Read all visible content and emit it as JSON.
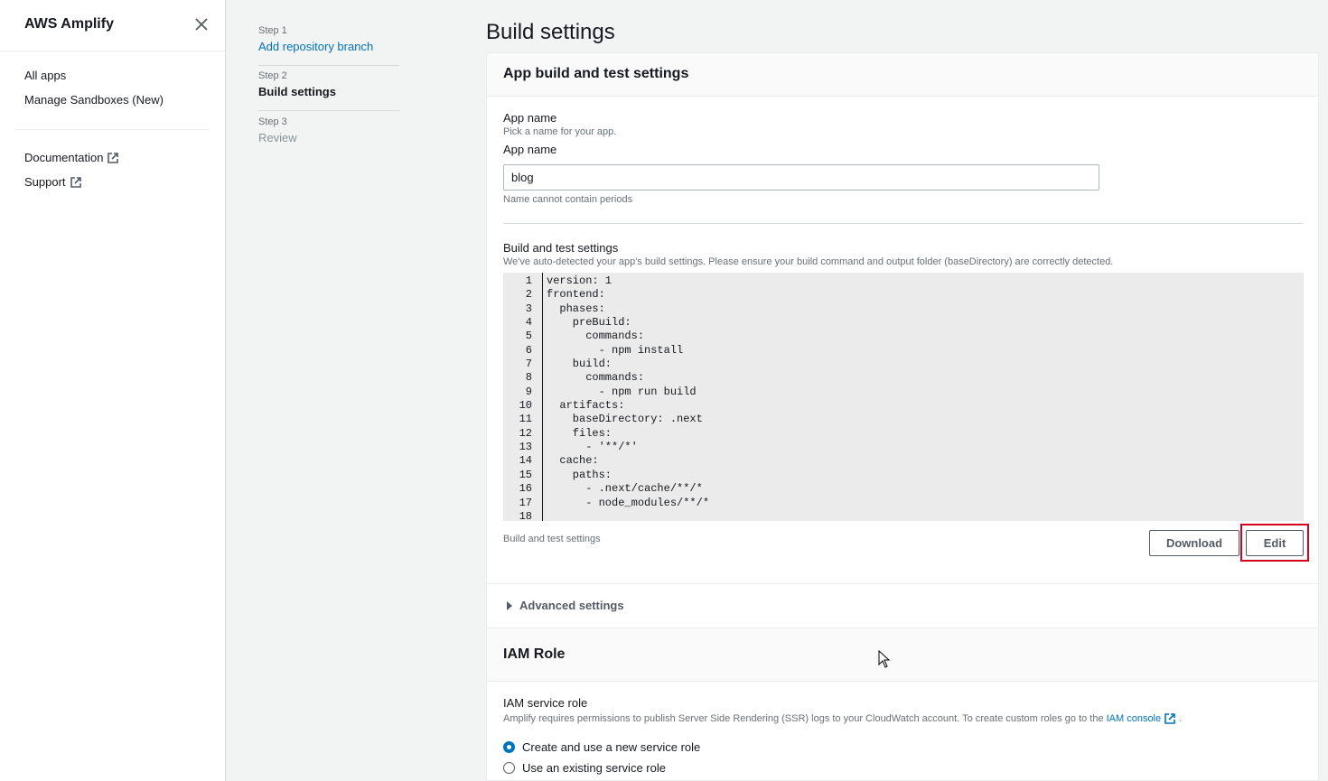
{
  "sidenav": {
    "title": "AWS Amplify",
    "items": [
      {
        "label": "All apps"
      },
      {
        "label": "Manage Sandboxes (New)"
      },
      {
        "label": "Documentation"
      },
      {
        "label": "Support"
      }
    ]
  },
  "steps": [
    {
      "num": "Step 1",
      "label": "Add repository branch"
    },
    {
      "num": "Step 2",
      "label": "Build settings"
    },
    {
      "num": "Step 3",
      "label": "Review"
    }
  ],
  "page": {
    "title": "Build settings"
  },
  "app_build": {
    "header": "App build and test settings",
    "app_name_section_label": "App name",
    "app_name_section_desc": "Pick a name for your app.",
    "app_name_field_label": "App name",
    "app_name_value": "blog",
    "app_name_constraint": "Name cannot contain periods",
    "build_settings_label": "Build and test settings",
    "build_settings_desc": "We've auto-detected your app's build settings. Please ensure your build command and output folder (baseDirectory) are correctly detected.",
    "code_lines": [
      "version: 1",
      "frontend:",
      "  phases:",
      "    preBuild:",
      "      commands:",
      "        - npm install",
      "    build:",
      "      commands:",
      "        - npm run build",
      "  artifacts:",
      "    baseDirectory: .next",
      "    files:",
      "      - '**/*'",
      "  cache:",
      "    paths:",
      "      - .next/cache/**/*",
      "      - node_modules/**/*",
      ""
    ],
    "line_numbers": [
      "1",
      "2",
      "3",
      "4",
      "5",
      "6",
      "7",
      "8",
      "9",
      "10",
      "11",
      "12",
      "13",
      "14",
      "15",
      "16",
      "17",
      "18"
    ],
    "footer_caption": "Build and test settings",
    "download_label": "Download",
    "edit_label": "Edit"
  },
  "advanced": {
    "label": "Advanced settings"
  },
  "iam": {
    "header": "IAM Role",
    "service_role_label": "IAM service role",
    "service_role_desc": "Amplify requires permissions to publish Server Side Rendering (SSR) logs to your CloudWatch account. To create custom roles go to the",
    "iam_console_link": "IAM console",
    "desc_end": ".",
    "options": [
      {
        "label": "Create and use a new service role",
        "checked": true
      },
      {
        "label": "Use an existing service role",
        "checked": false
      }
    ]
  },
  "colors": {
    "link": "#0073bb",
    "highlight": "#d9001b"
  }
}
